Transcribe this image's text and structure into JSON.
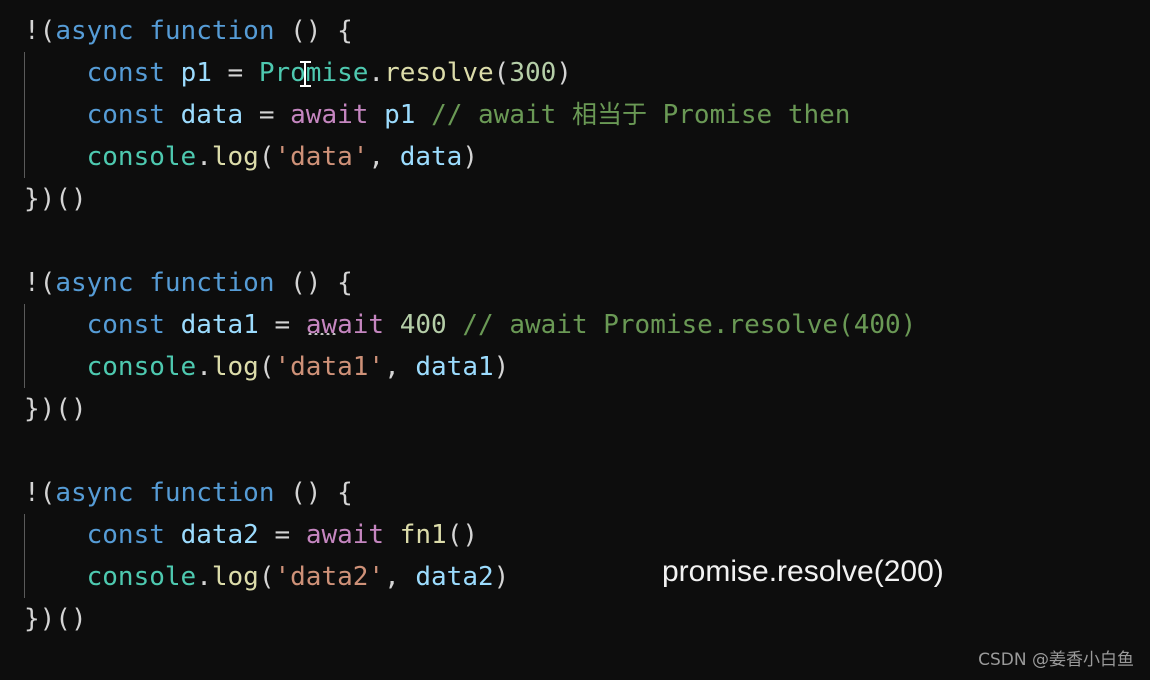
{
  "editor": {
    "background_color": "#0d0d0d",
    "default_text_color": "#d4d4d4",
    "blocks": [
      {
        "id": "block-1",
        "lines": [
          {
            "id": "b1-l1",
            "tokens": [
              {
                "text": "!(",
                "kind": "plain"
              },
              {
                "text": "async",
                "kind": "keyword"
              },
              {
                "text": " ",
                "kind": "plain"
              },
              {
                "text": "function",
                "kind": "keyword"
              },
              {
                "text": " () {",
                "kind": "plain"
              }
            ]
          },
          {
            "id": "b1-l2",
            "tokens": [
              {
                "text": "    ",
                "kind": "plain"
              },
              {
                "text": "const",
                "kind": "keyword"
              },
              {
                "text": " ",
                "kind": "plain"
              },
              {
                "text": "p1",
                "kind": "variable"
              },
              {
                "text": " = ",
                "kind": "plain"
              },
              {
                "text": "Promise",
                "kind": "class"
              },
              {
                "text": ".",
                "kind": "plain"
              },
              {
                "text": "resolve",
                "kind": "function"
              },
              {
                "text": "(",
                "kind": "plain"
              },
              {
                "text": "300",
                "kind": "number"
              },
              {
                "text": ")",
                "kind": "plain"
              }
            ]
          },
          {
            "id": "b1-l3",
            "tokens": [
              {
                "text": "    ",
                "kind": "plain"
              },
              {
                "text": "const",
                "kind": "keyword"
              },
              {
                "text": " ",
                "kind": "plain"
              },
              {
                "text": "data",
                "kind": "variable"
              },
              {
                "text": " = ",
                "kind": "plain"
              },
              {
                "text": "await",
                "kind": "control"
              },
              {
                "text": " ",
                "kind": "plain"
              },
              {
                "text": "p1",
                "kind": "variable"
              },
              {
                "text": " ",
                "kind": "plain"
              },
              {
                "text": "// await ",
                "kind": "comment"
              },
              {
                "text": "相当于",
                "kind": "comment-cn"
              },
              {
                "text": " Promise then",
                "kind": "comment"
              }
            ]
          },
          {
            "id": "b1-l4",
            "tokens": [
              {
                "text": "    ",
                "kind": "plain"
              },
              {
                "text": "console",
                "kind": "class"
              },
              {
                "text": ".",
                "kind": "plain"
              },
              {
                "text": "log",
                "kind": "function"
              },
              {
                "text": "(",
                "kind": "plain"
              },
              {
                "text": "'data'",
                "kind": "string"
              },
              {
                "text": ", ",
                "kind": "plain"
              },
              {
                "text": "data",
                "kind": "variable"
              },
              {
                "text": ")",
                "kind": "plain"
              }
            ]
          },
          {
            "id": "b1-l5",
            "tokens": [
              {
                "text": "})()",
                "kind": "plain"
              }
            ]
          }
        ]
      },
      {
        "id": "block-2",
        "lines": [
          {
            "id": "b2-l1",
            "tokens": [
              {
                "text": "!(",
                "kind": "plain"
              },
              {
                "text": "async",
                "kind": "keyword"
              },
              {
                "text": " ",
                "kind": "plain"
              },
              {
                "text": "function",
                "kind": "keyword"
              },
              {
                "text": " () {",
                "kind": "plain"
              }
            ]
          },
          {
            "id": "b2-l2",
            "tokens": [
              {
                "text": "    ",
                "kind": "plain"
              },
              {
                "text": "const",
                "kind": "keyword"
              },
              {
                "text": " ",
                "kind": "plain"
              },
              {
                "text": "data1",
                "kind": "variable"
              },
              {
                "text": " = ",
                "kind": "plain"
              },
              {
                "text": "await",
                "kind": "control",
                "underline": "dots"
              },
              {
                "text": " ",
                "kind": "plain"
              },
              {
                "text": "400",
                "kind": "number"
              },
              {
                "text": " ",
                "kind": "plain"
              },
              {
                "text": "// await Promise.resolve(400)",
                "kind": "comment"
              }
            ]
          },
          {
            "id": "b2-l3",
            "tokens": [
              {
                "text": "    ",
                "kind": "plain"
              },
              {
                "text": "console",
                "kind": "class"
              },
              {
                "text": ".",
                "kind": "plain"
              },
              {
                "text": "log",
                "kind": "function"
              },
              {
                "text": "(",
                "kind": "plain"
              },
              {
                "text": "'data1'",
                "kind": "string"
              },
              {
                "text": ", ",
                "kind": "plain"
              },
              {
                "text": "data1",
                "kind": "variable"
              },
              {
                "text": ")",
                "kind": "plain"
              }
            ]
          },
          {
            "id": "b2-l4",
            "tokens": [
              {
                "text": "})()",
                "kind": "plain"
              }
            ]
          }
        ]
      },
      {
        "id": "block-3",
        "lines": [
          {
            "id": "b3-l1",
            "tokens": [
              {
                "text": "!(",
                "kind": "plain"
              },
              {
                "text": "async",
                "kind": "keyword"
              },
              {
                "text": " ",
                "kind": "plain"
              },
              {
                "text": "function",
                "kind": "keyword"
              },
              {
                "text": " () {",
                "kind": "plain"
              }
            ]
          },
          {
            "id": "b3-l2",
            "tokens": [
              {
                "text": "    ",
                "kind": "plain"
              },
              {
                "text": "const",
                "kind": "keyword"
              },
              {
                "text": " ",
                "kind": "plain"
              },
              {
                "text": "data2",
                "kind": "variable"
              },
              {
                "text": " = ",
                "kind": "plain"
              },
              {
                "text": "await",
                "kind": "control"
              },
              {
                "text": " ",
                "kind": "plain"
              },
              {
                "text": "fn1",
                "kind": "function"
              },
              {
                "text": "()",
                "kind": "plain"
              }
            ]
          },
          {
            "id": "b3-l3",
            "tokens": [
              {
                "text": "    ",
                "kind": "plain"
              },
              {
                "text": "console",
                "kind": "class"
              },
              {
                "text": ".",
                "kind": "plain"
              },
              {
                "text": "log",
                "kind": "function"
              },
              {
                "text": "(",
                "kind": "plain"
              },
              {
                "text": "'data2'",
                "kind": "string"
              },
              {
                "text": ", ",
                "kind": "plain"
              },
              {
                "text": "data2",
                "kind": "variable"
              },
              {
                "text": ")",
                "kind": "plain"
              }
            ]
          },
          {
            "id": "b3-l4",
            "tokens": [
              {
                "text": "})()",
                "kind": "plain"
              }
            ]
          }
        ]
      }
    ]
  },
  "annotation": {
    "text": "promise.resolve(200)",
    "color": "#f2f2f2"
  },
  "watermark": {
    "text": "CSDN @姜香小白鱼",
    "color": "#9a9a9a"
  },
  "cursor": {
    "name": "text-ibeam-cursor"
  },
  "palette": {
    "background": "#0d0d0d",
    "plain": "#d4d4d4",
    "keyword": "#569cd6",
    "control": "#c586c0",
    "variable": "#9cdcfe",
    "class": "#4ec9b0",
    "function": "#dcdcaa",
    "string": "#ce9178",
    "number": "#b5cea8",
    "comment": "#6a9955",
    "indent_guide": "#5a5a5a"
  }
}
